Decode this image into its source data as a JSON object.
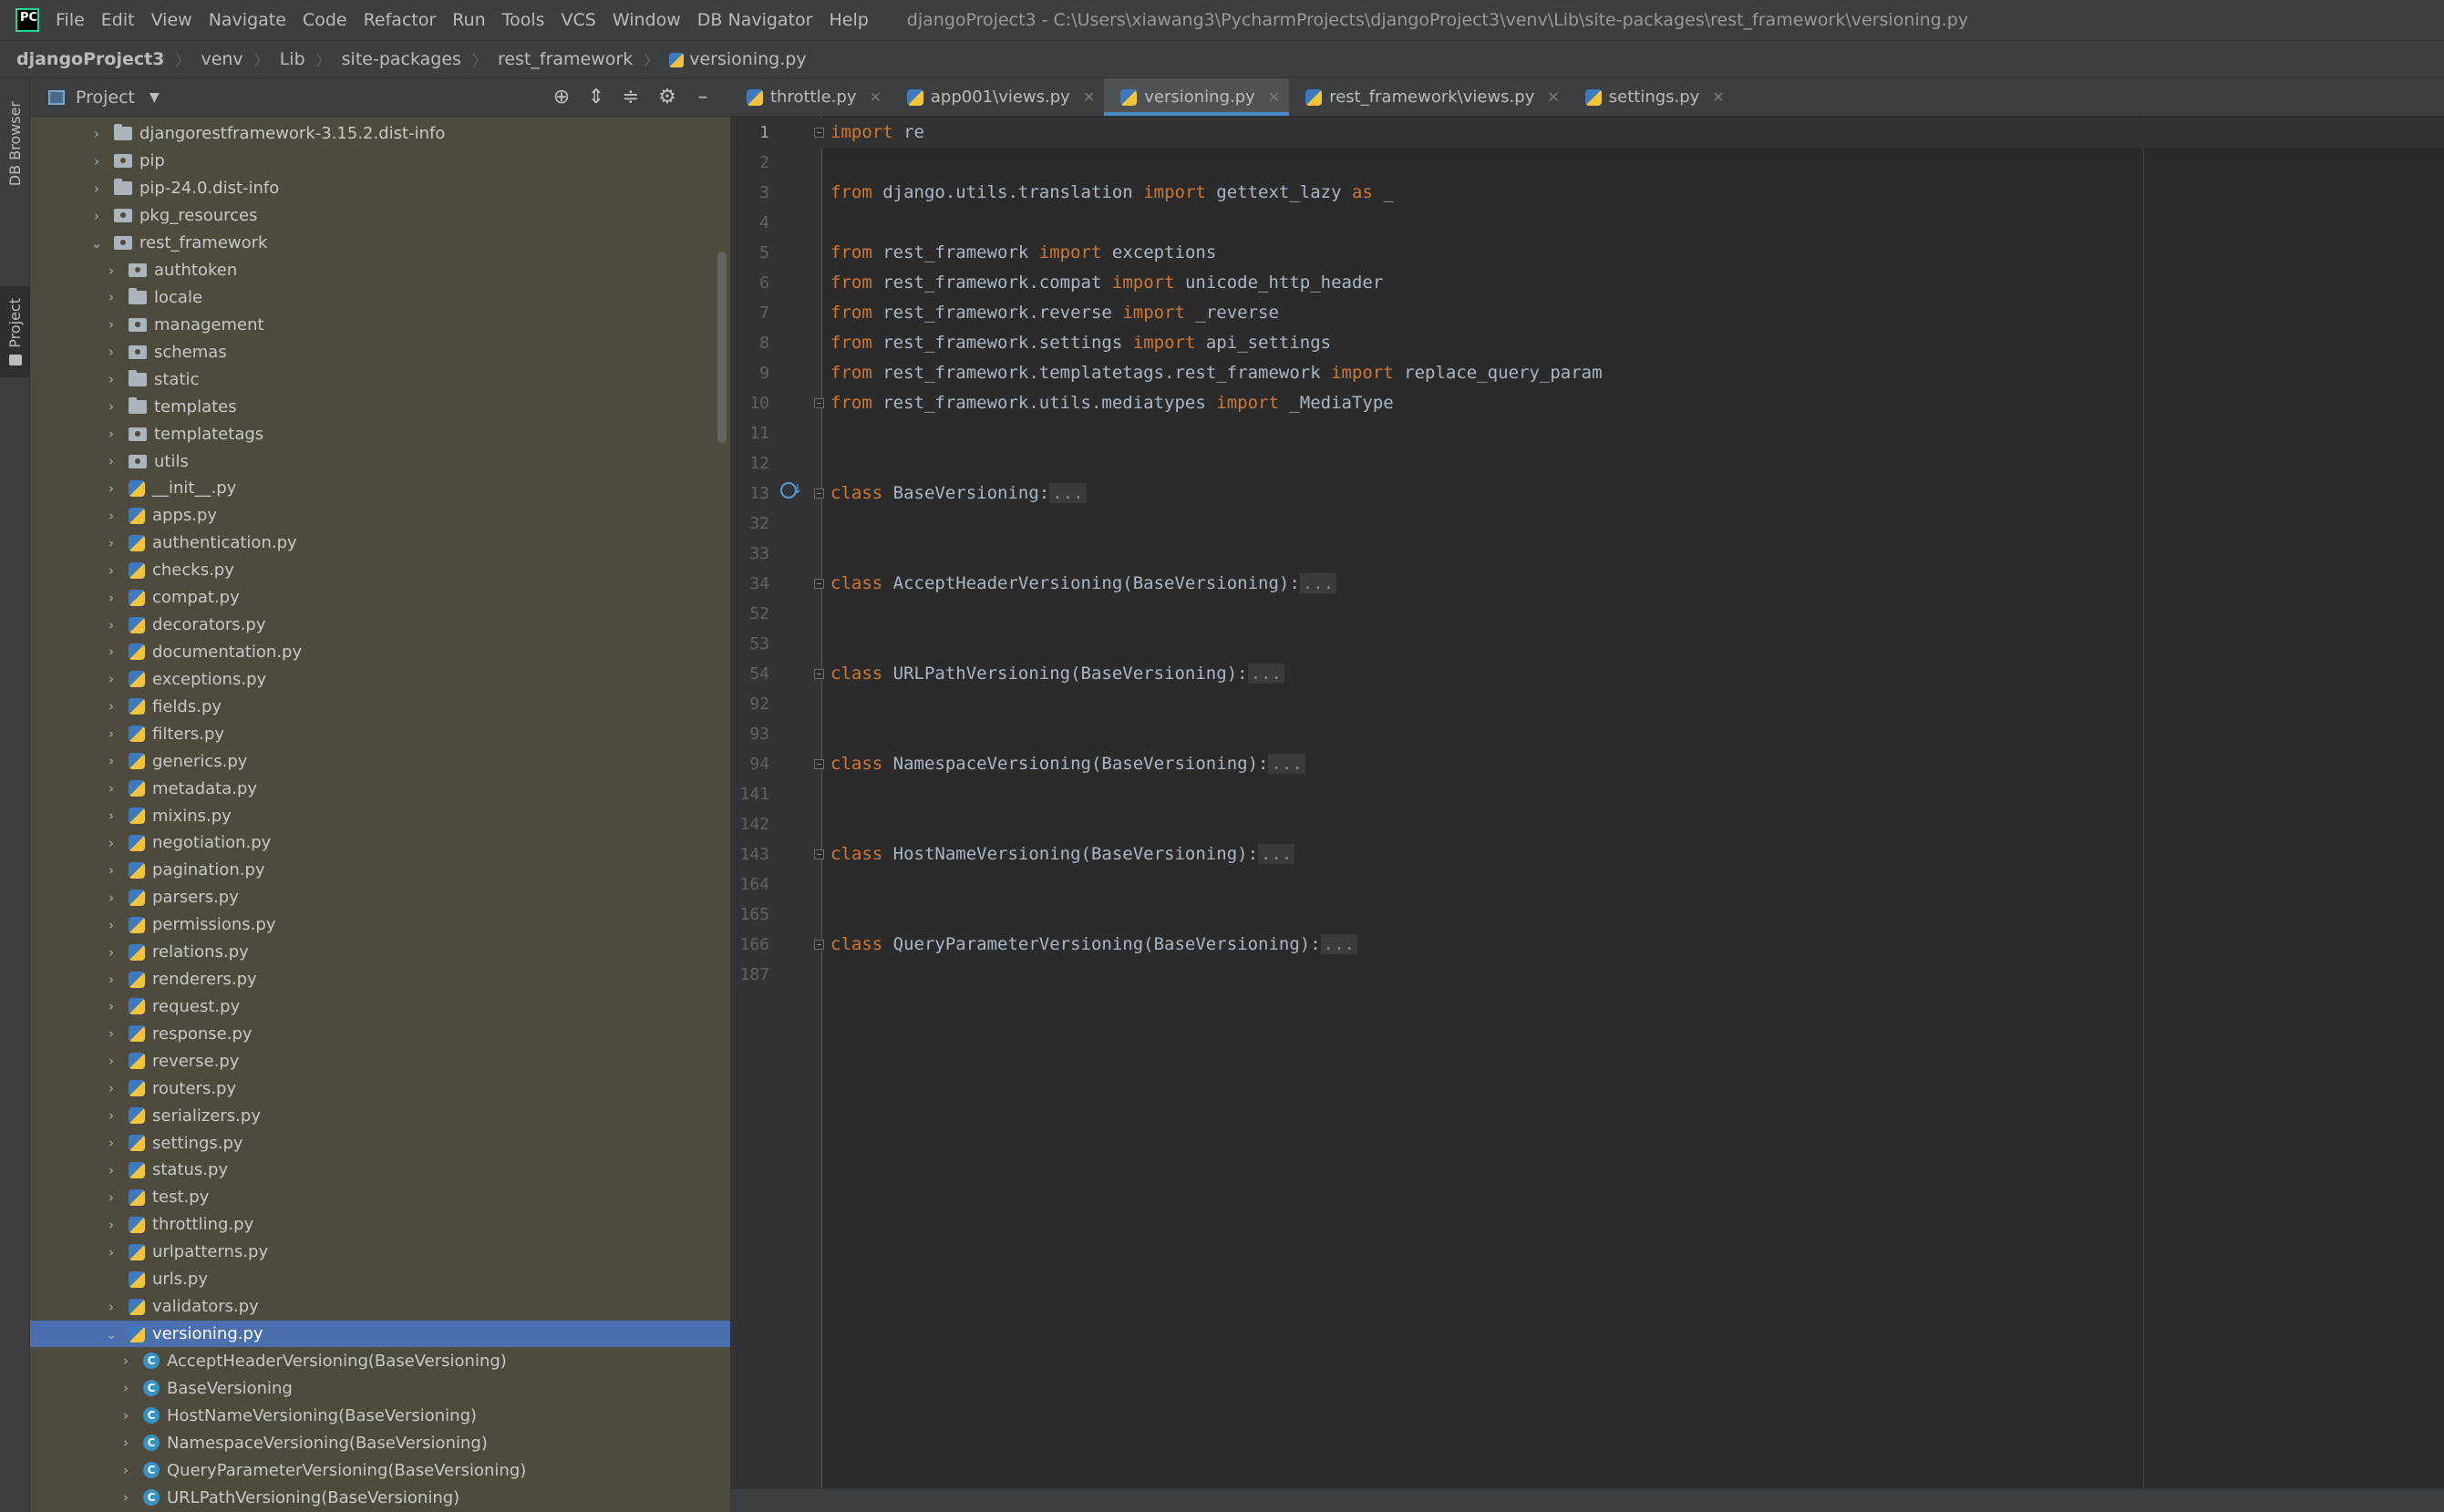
{
  "menubar": {
    "logo": "PC",
    "items": [
      "File",
      "Edit",
      "View",
      "Navigate",
      "Code",
      "Refactor",
      "Run",
      "Tools",
      "VCS",
      "Window",
      "DB Navigator",
      "Help"
    ],
    "window_title": "djangoProject3 - C:\\Users\\xiawang3\\PycharmProjects\\djangoProject3\\venv\\Lib\\site-packages\\rest_framework\\versioning.py"
  },
  "breadcrumb": [
    "djangoProject3",
    "venv",
    "Lib",
    "site-packages",
    "rest_framework",
    "versioning.py"
  ],
  "tool_strip": {
    "db_browser": "DB Browser",
    "project": "Project"
  },
  "project_panel": {
    "title": "Project",
    "tree": [
      {
        "label": "djangorestframework-3.15.2.dist-info",
        "depth": 0,
        "icon": "folder-icon",
        "chevron": "right"
      },
      {
        "label": "pip",
        "depth": 0,
        "icon": "package-folder-icon",
        "chevron": "right"
      },
      {
        "label": "pip-24.0.dist-info",
        "depth": 0,
        "icon": "folder-icon",
        "chevron": "right"
      },
      {
        "label": "pkg_resources",
        "depth": 0,
        "icon": "package-folder-icon",
        "chevron": "right"
      },
      {
        "label": "rest_framework",
        "depth": 0,
        "icon": "package-folder-icon",
        "chevron": "down"
      },
      {
        "label": "authtoken",
        "depth": 1,
        "icon": "package-folder-icon",
        "chevron": "right"
      },
      {
        "label": "locale",
        "depth": 1,
        "icon": "folder-icon",
        "chevron": "right"
      },
      {
        "label": "management",
        "depth": 1,
        "icon": "package-folder-icon",
        "chevron": "right"
      },
      {
        "label": "schemas",
        "depth": 1,
        "icon": "package-folder-icon",
        "chevron": "right"
      },
      {
        "label": "static",
        "depth": 1,
        "icon": "folder-icon",
        "chevron": "right"
      },
      {
        "label": "templates",
        "depth": 1,
        "icon": "folder-icon",
        "chevron": "right"
      },
      {
        "label": "templatetags",
        "depth": 1,
        "icon": "package-folder-icon",
        "chevron": "right"
      },
      {
        "label": "utils",
        "depth": 1,
        "icon": "package-folder-icon",
        "chevron": "right"
      },
      {
        "label": "__init__.py",
        "depth": 1,
        "icon": "python-file-icon",
        "chevron": "right"
      },
      {
        "label": "apps.py",
        "depth": 1,
        "icon": "python-file-icon",
        "chevron": "right"
      },
      {
        "label": "authentication.py",
        "depth": 1,
        "icon": "python-file-icon",
        "chevron": "right"
      },
      {
        "label": "checks.py",
        "depth": 1,
        "icon": "python-file-icon",
        "chevron": "right"
      },
      {
        "label": "compat.py",
        "depth": 1,
        "icon": "python-file-icon",
        "chevron": "right"
      },
      {
        "label": "decorators.py",
        "depth": 1,
        "icon": "python-file-icon",
        "chevron": "right"
      },
      {
        "label": "documentation.py",
        "depth": 1,
        "icon": "python-file-icon",
        "chevron": "right"
      },
      {
        "label": "exceptions.py",
        "depth": 1,
        "icon": "python-file-icon",
        "chevron": "right"
      },
      {
        "label": "fields.py",
        "depth": 1,
        "icon": "python-file-icon",
        "chevron": "right"
      },
      {
        "label": "filters.py",
        "depth": 1,
        "icon": "python-file-icon",
        "chevron": "right"
      },
      {
        "label": "generics.py",
        "depth": 1,
        "icon": "python-file-icon",
        "chevron": "right"
      },
      {
        "label": "metadata.py",
        "depth": 1,
        "icon": "python-file-icon",
        "chevron": "right"
      },
      {
        "label": "mixins.py",
        "depth": 1,
        "icon": "python-file-icon",
        "chevron": "right"
      },
      {
        "label": "negotiation.py",
        "depth": 1,
        "icon": "python-file-icon",
        "chevron": "right"
      },
      {
        "label": "pagination.py",
        "depth": 1,
        "icon": "python-file-icon",
        "chevron": "right"
      },
      {
        "label": "parsers.py",
        "depth": 1,
        "icon": "python-file-icon",
        "chevron": "right"
      },
      {
        "label": "permissions.py",
        "depth": 1,
        "icon": "python-file-icon",
        "chevron": "right"
      },
      {
        "label": "relations.py",
        "depth": 1,
        "icon": "python-file-icon",
        "chevron": "right"
      },
      {
        "label": "renderers.py",
        "depth": 1,
        "icon": "python-file-icon",
        "chevron": "right"
      },
      {
        "label": "request.py",
        "depth": 1,
        "icon": "python-file-icon",
        "chevron": "right"
      },
      {
        "label": "response.py",
        "depth": 1,
        "icon": "python-file-icon",
        "chevron": "right"
      },
      {
        "label": "reverse.py",
        "depth": 1,
        "icon": "python-file-icon",
        "chevron": "right"
      },
      {
        "label": "routers.py",
        "depth": 1,
        "icon": "python-file-icon",
        "chevron": "right"
      },
      {
        "label": "serializers.py",
        "depth": 1,
        "icon": "python-file-icon",
        "chevron": "right"
      },
      {
        "label": "settings.py",
        "depth": 1,
        "icon": "python-file-icon",
        "chevron": "right"
      },
      {
        "label": "status.py",
        "depth": 1,
        "icon": "python-file-icon",
        "chevron": "right"
      },
      {
        "label": "test.py",
        "depth": 1,
        "icon": "python-file-icon",
        "chevron": "right"
      },
      {
        "label": "throttling.py",
        "depth": 1,
        "icon": "python-file-icon",
        "chevron": "right"
      },
      {
        "label": "urlpatterns.py",
        "depth": 1,
        "icon": "python-file-icon",
        "chevron": "right"
      },
      {
        "label": "urls.py",
        "depth": 1,
        "icon": "python-file-icon",
        "chevron": "none"
      },
      {
        "label": "validators.py",
        "depth": 1,
        "icon": "python-file-icon",
        "chevron": "right"
      },
      {
        "label": "versioning.py",
        "depth": 1,
        "icon": "python-file-icon",
        "chevron": "down",
        "selected": true
      },
      {
        "label": "AcceptHeaderVersioning(BaseVersioning)",
        "depth": 2,
        "icon": "class-icon",
        "chevron": "right"
      },
      {
        "label": "BaseVersioning",
        "depth": 2,
        "icon": "class-icon",
        "chevron": "right"
      },
      {
        "label": "HostNameVersioning(BaseVersioning)",
        "depth": 2,
        "icon": "class-icon",
        "chevron": "right"
      },
      {
        "label": "NamespaceVersioning(BaseVersioning)",
        "depth": 2,
        "icon": "class-icon",
        "chevron": "right"
      },
      {
        "label": "QueryParameterVersioning(BaseVersioning)",
        "depth": 2,
        "icon": "class-icon",
        "chevron": "right"
      },
      {
        "label": "URLPathVersioning(BaseVersioning)",
        "depth": 2,
        "icon": "class-icon",
        "chevron": "right"
      }
    ]
  },
  "tabs": [
    {
      "label": "throttle.py",
      "active": false
    },
    {
      "label": "app001\\views.py",
      "active": false
    },
    {
      "label": "versioning.py",
      "active": true
    },
    {
      "label": "rest_framework\\views.py",
      "active": false
    },
    {
      "label": "settings.py",
      "active": false
    }
  ],
  "editor": {
    "lines": [
      {
        "num": "1",
        "code": [
          [
            "kw",
            "import"
          ],
          [
            "t",
            " re"
          ]
        ],
        "fold": true,
        "current": true
      },
      {
        "num": "2",
        "code": []
      },
      {
        "num": "3",
        "code": [
          [
            "kw",
            "from"
          ],
          [
            "t",
            " django.utils.translation "
          ],
          [
            "kw",
            "import"
          ],
          [
            "t",
            " gettext_lazy "
          ],
          [
            "kw",
            "as"
          ],
          [
            "t",
            " _"
          ]
        ]
      },
      {
        "num": "4",
        "code": []
      },
      {
        "num": "5",
        "code": [
          [
            "kw",
            "from"
          ],
          [
            "t",
            " rest_framework "
          ],
          [
            "kw",
            "import"
          ],
          [
            "t",
            " exceptions"
          ]
        ]
      },
      {
        "num": "6",
        "code": [
          [
            "kw",
            "from"
          ],
          [
            "t",
            " rest_framework.compat "
          ],
          [
            "kw",
            "import"
          ],
          [
            "t",
            " unicode_http_header"
          ]
        ]
      },
      {
        "num": "7",
        "code": [
          [
            "kw",
            "from"
          ],
          [
            "t",
            " rest_framework.reverse "
          ],
          [
            "kw",
            "import"
          ],
          [
            "t",
            " _reverse"
          ]
        ]
      },
      {
        "num": "8",
        "code": [
          [
            "kw",
            "from"
          ],
          [
            "t",
            " rest_framework.settings "
          ],
          [
            "kw",
            "import"
          ],
          [
            "t",
            " api_settings"
          ]
        ]
      },
      {
        "num": "9",
        "code": [
          [
            "kw",
            "from"
          ],
          [
            "t",
            " rest_framework.templatetags.rest_framework "
          ],
          [
            "kw",
            "import"
          ],
          [
            "t",
            " replace_query_param"
          ]
        ]
      },
      {
        "num": "10",
        "code": [
          [
            "kw",
            "from"
          ],
          [
            "t",
            " rest_framework.utils.mediatypes "
          ],
          [
            "kw",
            "import"
          ],
          [
            "t",
            " _MediaType"
          ]
        ],
        "fold": true
      },
      {
        "num": "11",
        "code": []
      },
      {
        "num": "12",
        "code": []
      },
      {
        "num": "13",
        "code": [
          [
            "kw",
            "class"
          ],
          [
            "t",
            " BaseVersioning:"
          ],
          [
            "e",
            "..."
          ]
        ],
        "fold": true,
        "mark": true
      },
      {
        "num": "32",
        "code": []
      },
      {
        "num": "33",
        "code": []
      },
      {
        "num": "34",
        "code": [
          [
            "kw",
            "class"
          ],
          [
            "t",
            " AcceptHeaderVersioning(BaseVersioning):"
          ],
          [
            "e",
            "..."
          ]
        ],
        "fold": true
      },
      {
        "num": "52",
        "code": []
      },
      {
        "num": "53",
        "code": []
      },
      {
        "num": "54",
        "code": [
          [
            "kw",
            "class"
          ],
          [
            "t",
            " URLPathVersioning(BaseVersioning):"
          ],
          [
            "e",
            "..."
          ]
        ],
        "fold": true
      },
      {
        "num": "92",
        "code": []
      },
      {
        "num": "93",
        "code": []
      },
      {
        "num": "94",
        "code": [
          [
            "kw",
            "class"
          ],
          [
            "t",
            " NamespaceVersioning(BaseVersioning):"
          ],
          [
            "e",
            "..."
          ]
        ],
        "fold": true
      },
      {
        "num": "141",
        "code": []
      },
      {
        "num": "142",
        "code": []
      },
      {
        "num": "143",
        "code": [
          [
            "kw",
            "class"
          ],
          [
            "t",
            " HostNameVersioning(BaseVersioning):"
          ],
          [
            "e",
            "..."
          ]
        ],
        "fold": true
      },
      {
        "num": "164",
        "code": []
      },
      {
        "num": "165",
        "code": []
      },
      {
        "num": "166",
        "code": [
          [
            "kw",
            "class"
          ],
          [
            "t",
            " QueryParameterVersioning(BaseVersioning):"
          ],
          [
            "e",
            "..."
          ]
        ],
        "fold": true
      },
      {
        "num": "187",
        "code": []
      }
    ]
  },
  "colors": {
    "keyword": "#cc7832",
    "text": "#a9b7c6",
    "selection": "#4b6eaf",
    "active_tab_underline": "#4a88c7"
  }
}
